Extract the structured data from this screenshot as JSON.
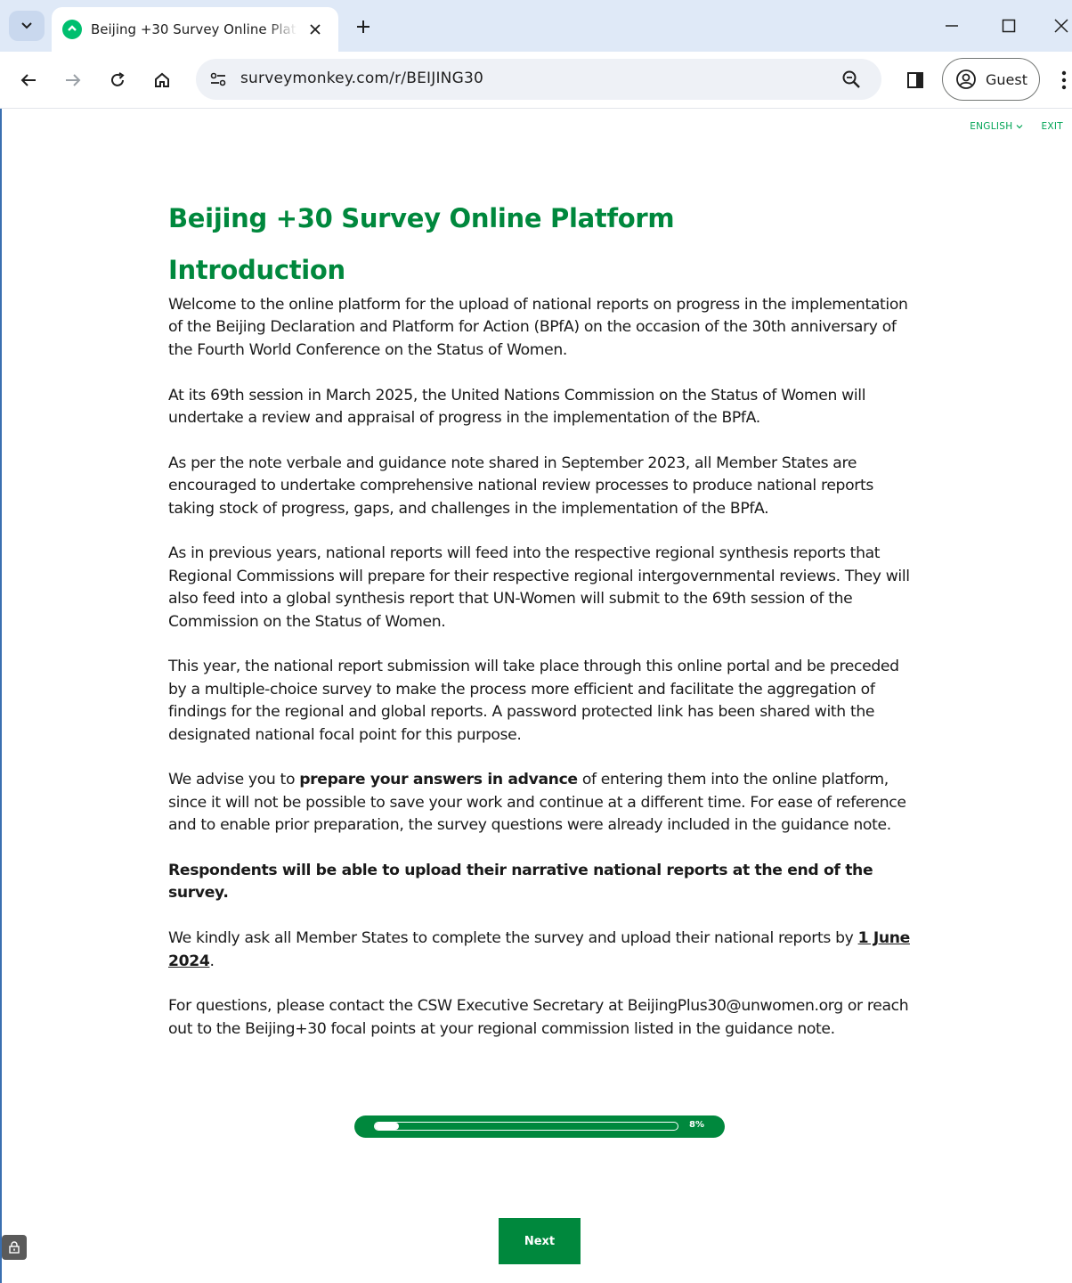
{
  "browser": {
    "tab_title": "Beijing +30 Survey Online Platform",
    "url": "surveymonkey.com/r/BEIJING30",
    "profile_label": "Guest",
    "colors": {
      "tabstrip": "#dfe9f7",
      "favicon": "#00bf6f"
    }
  },
  "header": {
    "language_label": "ENGLISH",
    "exit_label": "EXIT"
  },
  "survey": {
    "title": "Beijing +30 Survey Online Platform",
    "section_title": "Introduction",
    "paragraphs": {
      "p1": "Welcome to the online platform for the upload of national reports on progress in the implementation of the Beijing Declaration and Platform for Action (BPfA) on the occasion of the 30th anniversary of the Fourth World Conference on the Status of Women.",
      "p2": "At its 69th session in March 2025, the United Nations Commission on the Status of Women will undertake a review and appraisal of progress in the implementation of the BPfA.",
      "p3": "As per the note verbale and guidance note shared in September 2023, all Member States are encouraged to undertake comprehensive national review processes to produce national reports taking stock of progress, gaps, and challenges in the implementation of the BPfA.",
      "p4": "As in previous years, national reports will feed into the respective regional synthesis reports that Regional Commissions will prepare for their respective regional intergovernmental reviews. They will also feed into a global synthesis report that UN-Women will submit to the 69th session of the Commission on the Status of Women.",
      "p5": "This year, the national report submission will take place through this online portal and be preceded by a multiple-choice survey to make the process more efficient and facilitate the aggregation of findings for the regional and global reports. A password protected link has been shared with the designated national focal point for this purpose.",
      "p6_before": "We advise you to ",
      "p6_bold": "prepare your answers in advance",
      "p6_after": " of entering them into the online platform, since it will not be possible to save your work and continue at a different time. For ease of reference and to enable prior preparation, the survey questions were already included in the guidance note.",
      "p7": "Respondents will be able to upload their narrative national reports at the end of the survey.",
      "p8_before": "We kindly ask all Member States to complete the survey and upload their national reports by ",
      "p8_date": "1 June 2024",
      "p8_after": ".",
      "p9": "For questions, please contact the CSW Executive Secretary at BeijingPlus30@unwomen.org or reach out to the Beijing+30 focal points at your regional commission listed in the guidance note."
    },
    "progress": {
      "percent": 8,
      "label": "8%"
    },
    "next_label": "Next",
    "colors": {
      "primary": "#00883d",
      "link": "#00a455"
    }
  }
}
